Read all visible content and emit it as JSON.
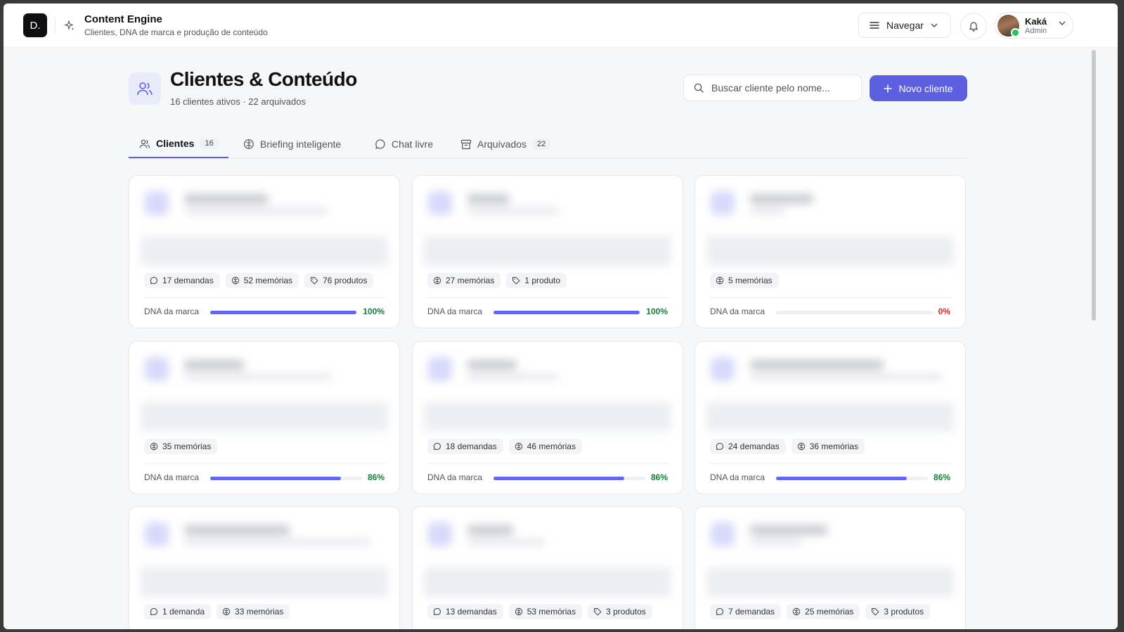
{
  "header": {
    "logo_text": "D.",
    "title": "Content Engine",
    "subtitle": "Clientes, DNA de marca e produção de conteúdo",
    "nav_label": "Navegar",
    "user": {
      "name": "Kaká",
      "role": "Admin"
    }
  },
  "page": {
    "title": "Clientes & Conteúdo",
    "subtitle": "16 clientes ativos · 22 arquivados",
    "search_placeholder": "Buscar cliente pelo nome...",
    "new_client_label": "Novo cliente"
  },
  "tabs": [
    {
      "label": "Clientes",
      "count": "16",
      "active": true,
      "icon": "users-icon"
    },
    {
      "label": "Briefing inteligente",
      "count": "",
      "active": false,
      "icon": "brain-icon"
    },
    {
      "label": "Chat livre",
      "count": "",
      "active": false,
      "icon": "chat-icon"
    },
    {
      "label": "Arquivados",
      "count": "22",
      "active": false,
      "icon": "archive-icon"
    }
  ],
  "dna_label": "DNA da marca",
  "accent_color": "#5b5fe0",
  "cards": [
    {
      "chips": [
        {
          "icon": "chat-icon",
          "text": "17 demandas"
        },
        {
          "icon": "brain-icon",
          "text": "52 memórias"
        },
        {
          "icon": "tag-icon",
          "text": "76 produtos"
        }
      ],
      "dna": "100%",
      "dna_value": 1.0
    },
    {
      "chips": [
        {
          "icon": "brain-icon",
          "text": "27 memórias"
        },
        {
          "icon": "tag-icon",
          "text": "1 produto"
        }
      ],
      "dna": "100%",
      "dna_value": 1.0
    },
    {
      "chips": [
        {
          "icon": "brain-icon",
          "text": "5 memórias"
        }
      ],
      "dna": "0%",
      "dna_value": 0.0
    },
    {
      "chips": [
        {
          "icon": "brain-icon",
          "text": "35 memórias"
        }
      ],
      "dna": "86%",
      "dna_value": 0.86
    },
    {
      "chips": [
        {
          "icon": "chat-icon",
          "text": "18 demandas"
        },
        {
          "icon": "brain-icon",
          "text": "46 memórias"
        }
      ],
      "dna": "86%",
      "dna_value": 0.86
    },
    {
      "chips": [
        {
          "icon": "chat-icon",
          "text": "24 demandas"
        },
        {
          "icon": "brain-icon",
          "text": "36 memórias"
        }
      ],
      "dna": "86%",
      "dna_value": 0.86
    },
    {
      "chips": [
        {
          "icon": "chat-icon",
          "text": "1 demanda"
        },
        {
          "icon": "brain-icon",
          "text": "33 memórias"
        }
      ],
      "dna": "",
      "dna_value": null
    },
    {
      "chips": [
        {
          "icon": "chat-icon",
          "text": "13 demandas"
        },
        {
          "icon": "brain-icon",
          "text": "53 memórias"
        },
        {
          "icon": "tag-icon",
          "text": "3 produtos"
        }
      ],
      "dna": "",
      "dna_value": null
    },
    {
      "chips": [
        {
          "icon": "chat-icon",
          "text": "7 demandas"
        },
        {
          "icon": "brain-icon",
          "text": "25 memórias"
        },
        {
          "icon": "tag-icon",
          "text": "3 produtos"
        }
      ],
      "dna": "",
      "dna_value": null
    }
  ]
}
